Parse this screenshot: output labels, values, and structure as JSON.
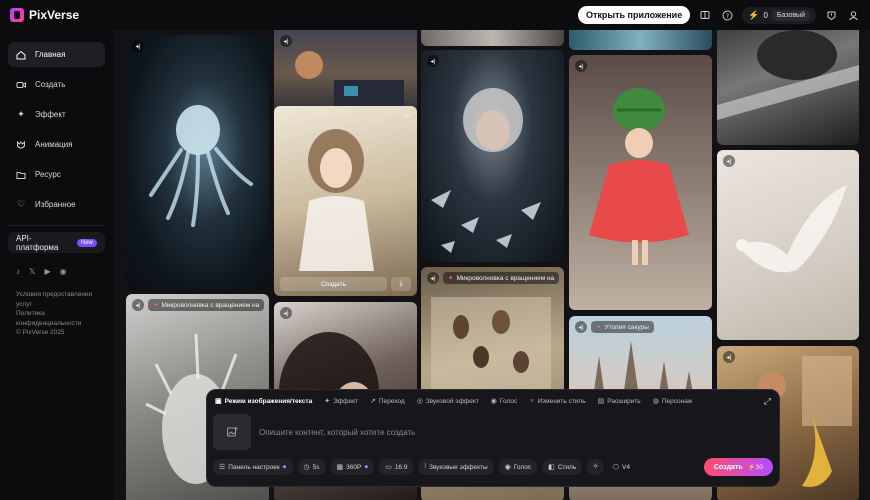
{
  "app": {
    "name": "PixVerse"
  },
  "topbar": {
    "open_app": "Открыть приложение",
    "credits": "0",
    "plan": "Базовый",
    "icons": [
      "book-icon",
      "help-icon",
      "bolt-icon",
      "notification-icon",
      "user-icon"
    ]
  },
  "sidebar": {
    "items": [
      {
        "label": "Главная",
        "icon": "home-icon",
        "active": true
      },
      {
        "label": "Создать",
        "icon": "video-camera-icon",
        "active": false
      },
      {
        "label": "Эффект",
        "icon": "sparkle-icon",
        "active": false
      },
      {
        "label": "Анимация",
        "icon": "animation-icon",
        "active": false
      },
      {
        "label": "Ресурс",
        "icon": "folder-icon",
        "active": false
      },
      {
        "label": "Избранное",
        "icon": "heart-icon",
        "active": false
      }
    ],
    "api": {
      "label": "API-платформа",
      "badge": "New"
    },
    "socials": [
      "tiktok-icon",
      "x-icon",
      "youtube-icon",
      "discord-icon"
    ],
    "legal": {
      "terms": "Условия предоставления услуг",
      "privacy": "Политика конфиденциальности",
      "copyright": "© PixVerse 2025"
    }
  },
  "feed": {
    "tag_microwave": "Микроволновка с вращением на",
    "tag_sakura": "Утопия сакуры",
    "create_label": "Создать"
  },
  "composer": {
    "modes": [
      {
        "label": "Режим изображения/текста",
        "icon": "image-icon",
        "active": true
      },
      {
        "label": "Эффект",
        "icon": "sparkle-icon",
        "active": false
      },
      {
        "label": "Переход",
        "icon": "transition-icon",
        "active": false
      },
      {
        "label": "Звуковой эффект",
        "icon": "sound-effect-icon",
        "active": false
      },
      {
        "label": "Голос",
        "icon": "voice-icon",
        "active": false
      },
      {
        "label": "Изменить стиль",
        "icon": "style-icon",
        "active": false
      },
      {
        "label": "Расширить",
        "icon": "extend-icon",
        "active": false
      },
      {
        "label": "Персонаж",
        "icon": "character-icon",
        "active": false
      }
    ],
    "placeholder": "Опишите контент, который хотите создать",
    "tools": {
      "panel": "Панель настроек",
      "duration": "5s",
      "quality": "360P",
      "ratio": "16:9",
      "sound_effects": "Звуковые эффекты",
      "voice": "Голос",
      "style": "Стиль"
    },
    "model": "V4",
    "create": "Создать",
    "cost": "30"
  },
  "colors": {
    "accent_start": "#ff4d6d",
    "accent_end": "#b34dff",
    "background": "#0c0c0e"
  }
}
